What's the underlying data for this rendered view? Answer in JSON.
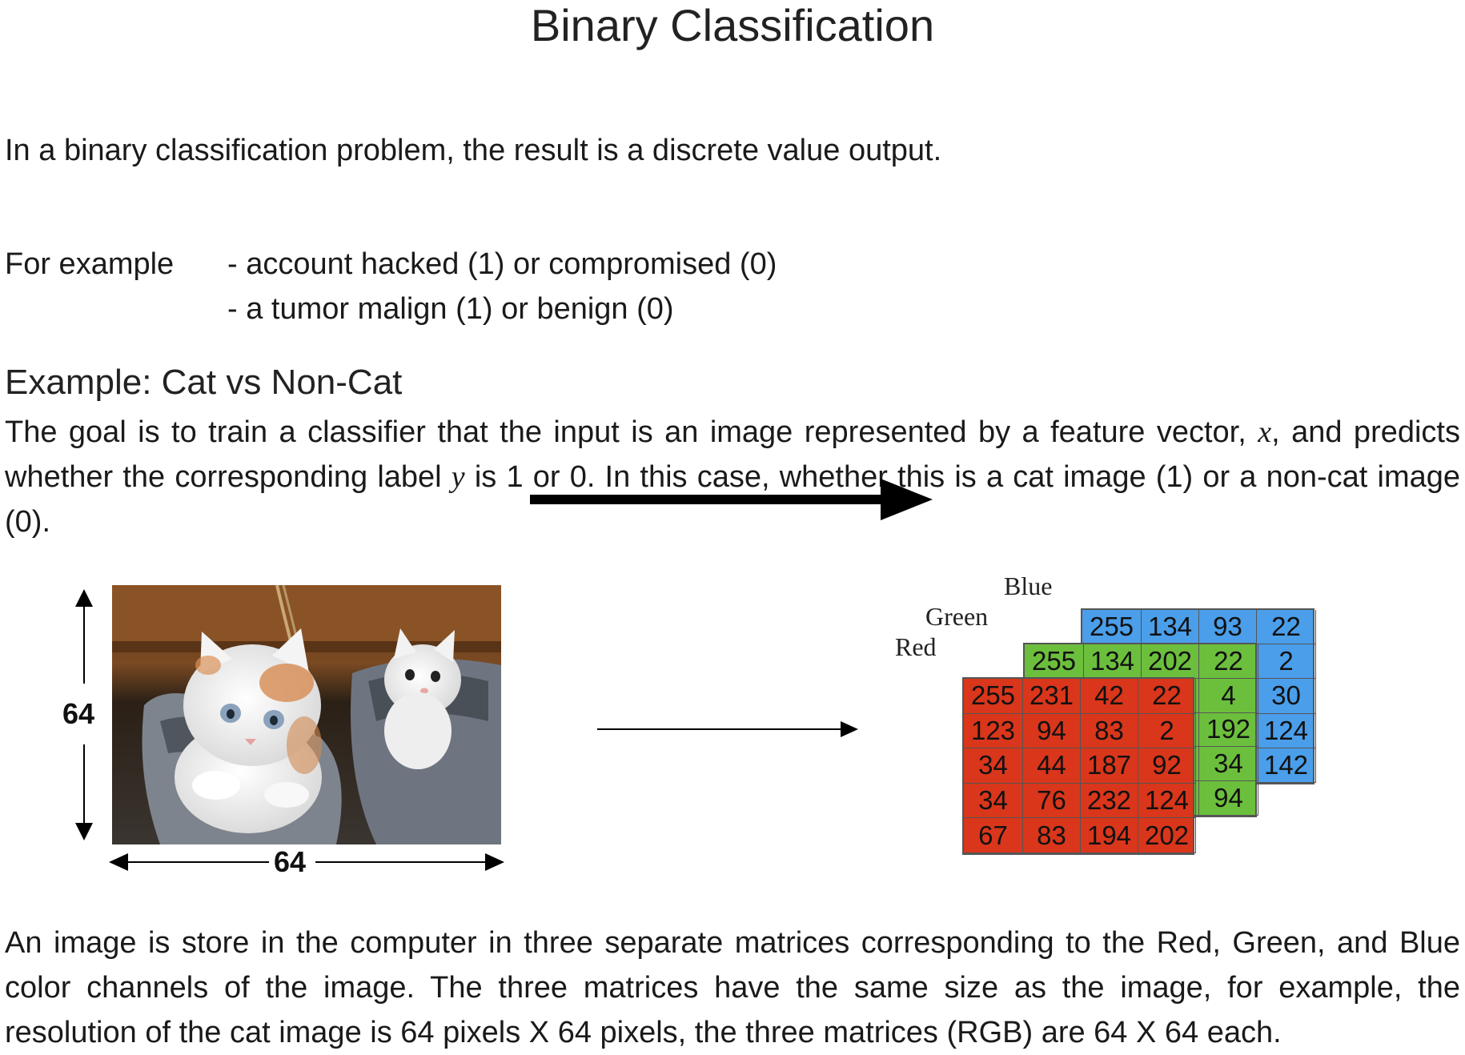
{
  "title": "Binary Classification",
  "intro": "In a binary classification problem, the result is a discrete value output.",
  "example_label": "For example",
  "example_items": [
    "- account hacked (1) or compromised (0)",
    "- a tumor malign (1) or benign (0)"
  ],
  "section_heading": "Example: Cat vs Non-Cat",
  "goal": {
    "line1_pre": "The goal is to train a classifier that the input is an image represented by a feature vector,",
    "line1_var": "x",
    "line1_post": ", and predicts",
    "line2_pre": "whether the corresponding label",
    "line2_var": "y",
    "line2_post": "is 1 or 0. In this case, whether this is a cat image (1) or a non-cat image",
    "line3": "(0)."
  },
  "figure": {
    "height_label": "64",
    "width_label": "64",
    "channel_labels": {
      "blue": "Blue",
      "green": "Green",
      "red": "Red"
    },
    "matrices": {
      "blue": [
        [
          "255",
          "134",
          "93",
          "22"
        ],
        [
          "",
          "",
          "",
          "2"
        ],
        [
          "",
          "",
          "",
          "30"
        ],
        [
          "",
          "",
          "",
          "124"
        ],
        [
          "",
          "",
          "",
          "142"
        ]
      ],
      "green": [
        [
          "255",
          "134",
          "202",
          "22"
        ],
        [
          "",
          "",
          "",
          "4"
        ],
        [
          "",
          "",
          "",
          "192"
        ],
        [
          "",
          "",
          "",
          "34"
        ],
        [
          "",
          "",
          "",
          "94"
        ]
      ],
      "red": [
        [
          "255",
          "231",
          "42",
          "22"
        ],
        [
          "123",
          "94",
          "83",
          "2"
        ],
        [
          "34",
          "44",
          "187",
          "92"
        ],
        [
          "34",
          "76",
          "232",
          "124"
        ],
        [
          "67",
          "83",
          "194",
          "202"
        ]
      ]
    },
    "colors": {
      "blue": "#4a9eea",
      "green": "#6cbf3d",
      "red": "#d9361b"
    }
  },
  "closing": [
    "An image is store in the computer in three separate matrices corresponding to the Red, Green, and Blue",
    "color channels of the image. The three matrices have the same size as the image, for example, the",
    "resolution of the cat image is 64 pixels X 64 pixels, the three matrices (RGB) are 64 X 64 each."
  ]
}
